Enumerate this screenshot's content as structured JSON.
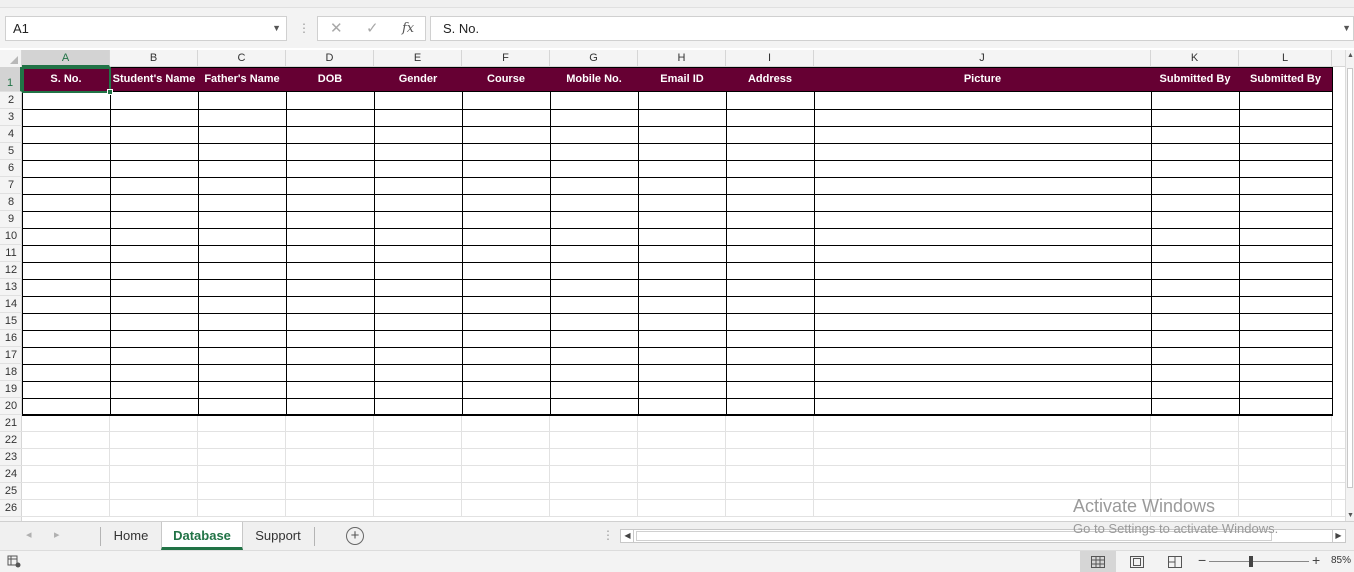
{
  "formula_bar": {
    "name_box": "A1",
    "cancel_icon": "✕",
    "enter_icon": "✓",
    "fx_label": "fx",
    "content": "S. No."
  },
  "columns": [
    {
      "letter": "A",
      "header": "S. No."
    },
    {
      "letter": "B",
      "header": "Student's Name"
    },
    {
      "letter": "C",
      "header": "Father's Name"
    },
    {
      "letter": "D",
      "header": "DOB"
    },
    {
      "letter": "E",
      "header": "Gender"
    },
    {
      "letter": "F",
      "header": "Course"
    },
    {
      "letter": "G",
      "header": "Mobile No."
    },
    {
      "letter": "H",
      "header": "Email ID"
    },
    {
      "letter": "I",
      "header": "Address"
    },
    {
      "letter": "J",
      "header": "Picture"
    },
    {
      "letter": "K",
      "header": "Submitted By"
    },
    {
      "letter": "L",
      "header": "Submitted By"
    }
  ],
  "rows": [
    "1",
    "2",
    "3",
    "4",
    "5",
    "6",
    "7",
    "8",
    "9",
    "10",
    "11",
    "12",
    "13",
    "14",
    "15",
    "16",
    "17",
    "18",
    "19",
    "20",
    "21",
    "22",
    "23",
    "24",
    "25",
    "26"
  ],
  "selected_cell": "A1",
  "header_fill_color": "#660033",
  "sheet_tabs": [
    {
      "label": "Home",
      "active": false
    },
    {
      "label": "Database",
      "active": true
    },
    {
      "label": "Support",
      "active": false
    }
  ],
  "watermark": {
    "line1": "Activate Windows",
    "line2": "Go to Settings to activate Windows."
  },
  "status_bar": {
    "zoom_label": "85%",
    "zoom_level_percent": 85,
    "view_modes": [
      "normal-view",
      "page-layout-view",
      "page-break-preview"
    ],
    "active_view": "normal-view"
  },
  "accent_color": "#217346"
}
